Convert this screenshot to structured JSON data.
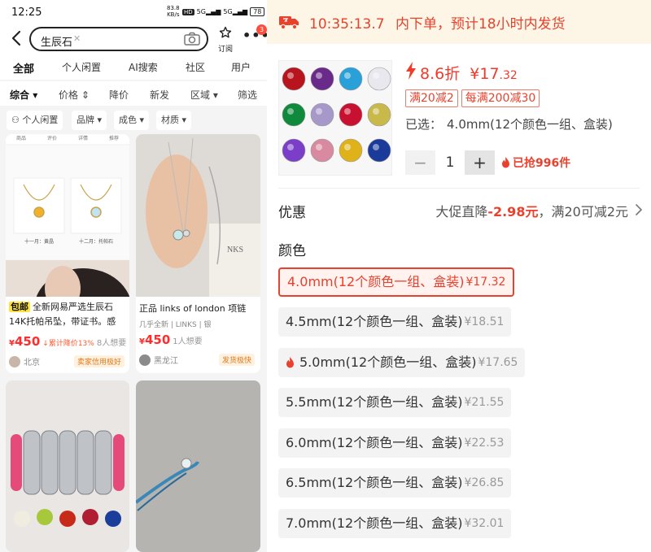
{
  "status_bar": {
    "time": "12:25",
    "net_speed": "83.8",
    "net_unit": "KB/s",
    "hd": "HD",
    "signal1": "5G",
    "signal2": "5G",
    "battery": "78"
  },
  "search": {
    "query": "生辰石",
    "subscribe_label": "订阅",
    "badge": "3"
  },
  "tabs": [
    "全部",
    "个人闲置",
    "AI搜索",
    "社区",
    "用户"
  ],
  "filters": [
    "综合",
    "价格",
    "降价",
    "新发",
    "区域",
    "筛选"
  ],
  "chips": [
    "个人闲置",
    "品牌",
    "成色",
    "材质"
  ],
  "cards": [
    {
      "img_tabs": [
        "商品",
        "评价",
        "详情",
        "推荐"
      ],
      "img_cap1": "十一月：黄晶",
      "img_cap2": "十二月：托帕石",
      "badge": "包邮",
      "title": "全新网易严选生辰石14K托帕吊坠，带证书。感",
      "price": "450",
      "drop": "累计降价13%",
      "wants": "8人想要",
      "location": "北京",
      "tag": "卖家信用极好"
    },
    {
      "title": "正品 links of london 项链",
      "subtitle": "几乎全新 | LINKS | 银",
      "price": "450",
      "wants": "1人想要",
      "location": "黑龙江",
      "tag": "发货极快"
    }
  ],
  "banner": {
    "time": "10:35:13.7",
    "text": "内下单，预计18小时内发货"
  },
  "product": {
    "discount": "8.6折",
    "price_main": "¥17",
    "price_cents": ".32",
    "coupons": [
      "满20减2",
      "每满200减30"
    ],
    "selected_label": "已选：",
    "selected_value": "4.0mm(12个颜色一组、盒装)",
    "qty_minus": "−",
    "qty": "1",
    "qty_plus": "+",
    "sold": "已抢996件",
    "gems": [
      "#b8141e",
      "#6a2a8a",
      "#2aa0d8",
      "#e8e8ee",
      "#0f8a3c",
      "#a698c8",
      "#c81030",
      "#c9b84a",
      "#7a3ec8",
      "#d98aa0",
      "#e0b21a",
      "#1a3b9a"
    ]
  },
  "promo": {
    "label": "优惠",
    "text_prefix": "大促直降",
    "amount": "-2.98元",
    "text_suffix": "，满20可减2元"
  },
  "color": {
    "label": "颜色",
    "options": [
      {
        "name": "4.0mm(12个颜色一组、盒装)",
        "price": "¥17.32",
        "selected": true,
        "hot": false
      },
      {
        "name": "4.5mm(12个颜色一组、盒装)",
        "price": "¥18.51",
        "selected": false,
        "hot": false
      },
      {
        "name": "5.0mm(12个颜色一组、盒装)",
        "price": "¥17.65",
        "selected": false,
        "hot": true
      },
      {
        "name": "5.5mm(12个颜色一组、盒装)",
        "price": "¥21.55",
        "selected": false,
        "hot": false
      },
      {
        "name": "6.0mm(12个颜色一组、盒装)",
        "price": "¥22.53",
        "selected": false,
        "hot": false
      },
      {
        "name": "6.5mm(12个颜色一组、盒装)",
        "price": "¥26.85",
        "selected": false,
        "hot": false
      },
      {
        "name": "7.0mm(12个颜色一组、盒装)",
        "price": "¥32.01",
        "selected": false,
        "hot": false
      }
    ]
  },
  "colors": {
    "accent": "#e8412d",
    "yellow": "#ffe23d",
    "banner_bg": "#fdf6e6"
  }
}
